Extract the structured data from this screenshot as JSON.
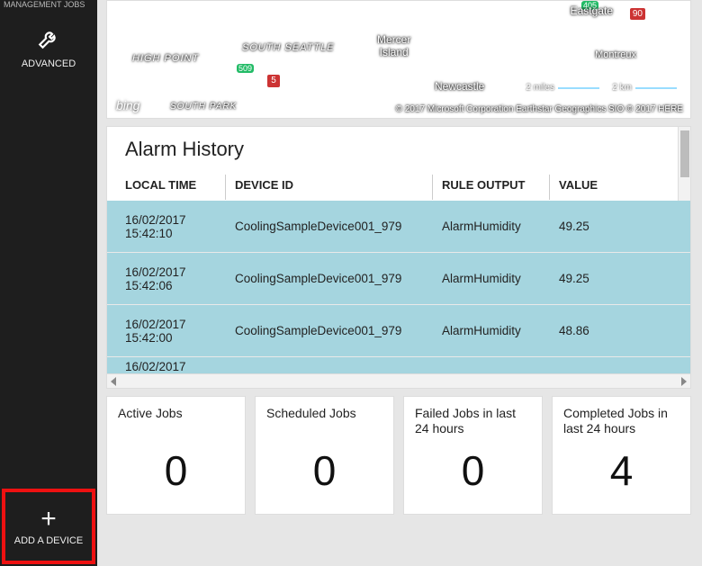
{
  "sidebar": {
    "top_truncated": "MANAGEMENT JOBS",
    "advanced_label": "ADVANCED",
    "add_device_label": "ADD A DEVICE"
  },
  "map": {
    "places": {
      "eastgate": "Eastgate",
      "mercer_island": "Mercer\nIsland",
      "south_seattle": "SOUTH SEATTLE",
      "high_point": "HIGH POINT",
      "newcastle": "Newcastle",
      "montreux": "Montreux",
      "south_park": "SOUTH PARK"
    },
    "routes": {
      "r90": "90",
      "r405": "405",
      "r509": "509",
      "r5": "5"
    },
    "scale_miles": "2 miles",
    "scale_km": "2 km",
    "bing": "bing",
    "attribution": "© 2017 Microsoft Corporation    Earthstar Geographics SIO    © 2017 HERE"
  },
  "alarm": {
    "title": "Alarm History",
    "columns": {
      "local_time": "LOCAL TIME",
      "device_id": "DEVICE ID",
      "rule_output": "RULE OUTPUT",
      "value": "VALUE"
    },
    "rows": [
      {
        "time": "16/02/2017 15:42:10",
        "device": "CoolingSampleDevice001_979",
        "rule": "AlarmHumidity",
        "value": "49.25"
      },
      {
        "time": "16/02/2017 15:42:06",
        "device": "CoolingSampleDevice001_979",
        "rule": "AlarmHumidity",
        "value": "49.25"
      },
      {
        "time": "16/02/2017 15:42:00",
        "device": "CoolingSampleDevice001_979",
        "rule": "AlarmHumidity",
        "value": "48.86"
      },
      {
        "time": "16/02/2017",
        "device": "",
        "rule": "",
        "value": ""
      }
    ]
  },
  "jobs": {
    "active": {
      "label": "Active Jobs",
      "value": "0"
    },
    "scheduled": {
      "label": "Scheduled Jobs",
      "value": "0"
    },
    "failed": {
      "label": "Failed Jobs in last 24 hours",
      "value": "0"
    },
    "completed": {
      "label": "Completed Jobs in last 24 hours",
      "value": "4"
    }
  }
}
